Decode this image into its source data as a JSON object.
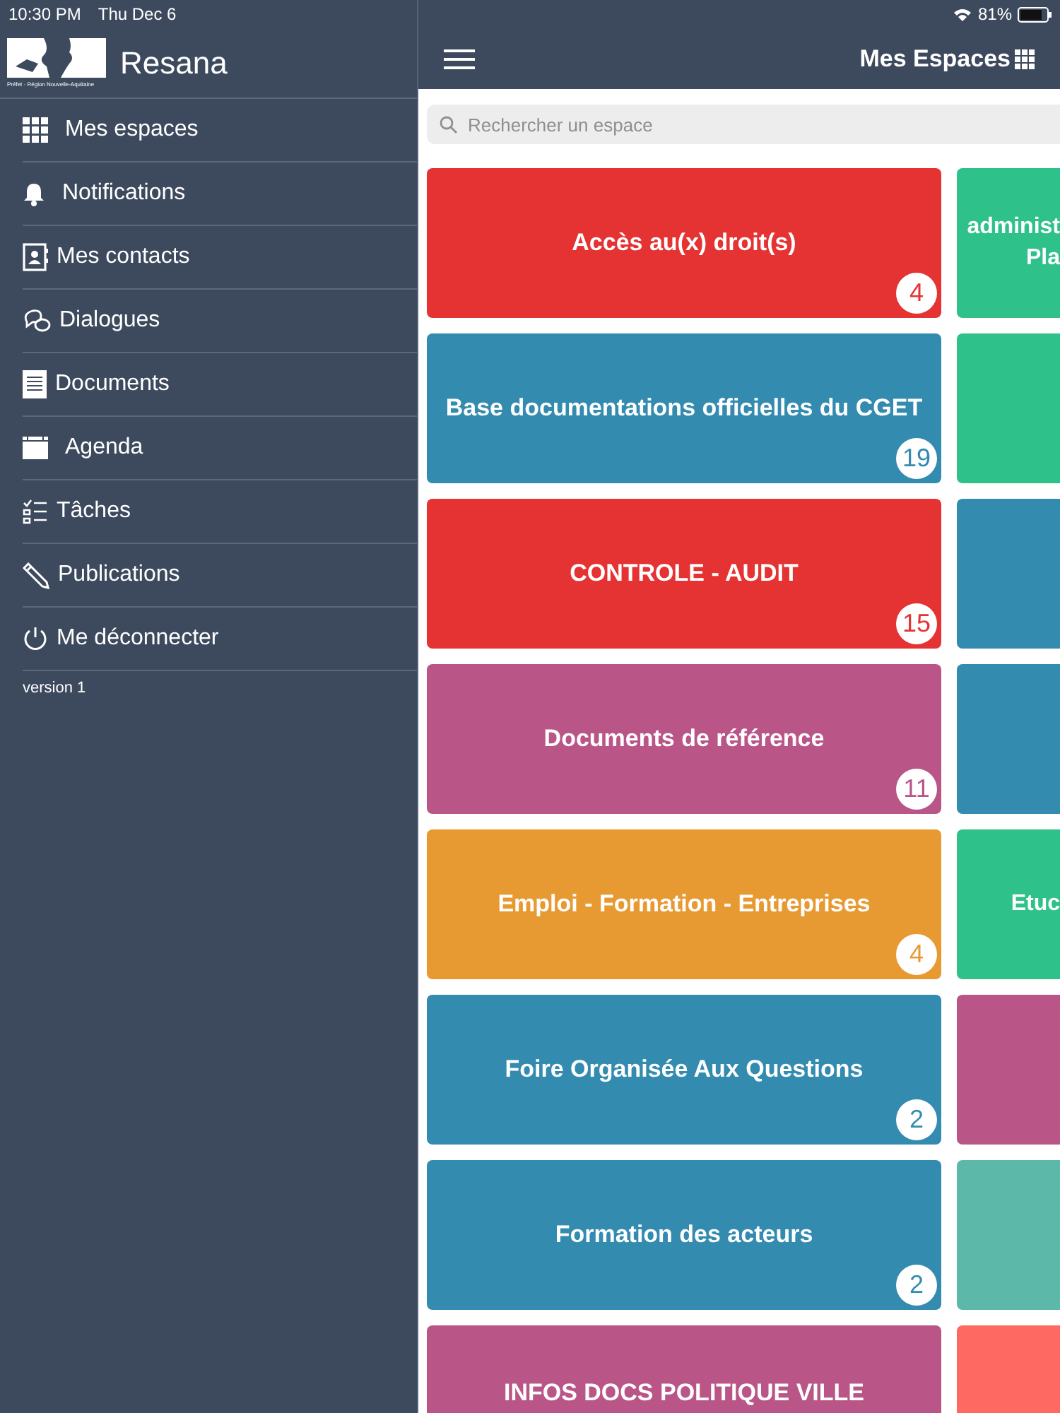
{
  "status_bar": {
    "time": "10:30 PM",
    "date": "Thu Dec 6",
    "battery": "81%"
  },
  "sidebar": {
    "app_name": "Resana",
    "logo_caption": "Préfet · Région Nouvelle-Aquitaine",
    "items": [
      {
        "kind": "grid",
        "label": "Mes espaces"
      },
      {
        "kind": "bell",
        "label": "Notifications"
      },
      {
        "kind": "contacts",
        "label": "Mes contacts"
      },
      {
        "kind": "chat",
        "label": "Dialogues"
      },
      {
        "kind": "document",
        "label": "Documents"
      },
      {
        "kind": "calendar",
        "label": "Agenda"
      },
      {
        "kind": "tasks",
        "label": "Tâches"
      },
      {
        "kind": "pencil",
        "label": "Publications"
      },
      {
        "kind": "power",
        "label": "Me déconnecter"
      }
    ],
    "version": "version 1"
  },
  "header": {
    "title": "Mes Espaces"
  },
  "search": {
    "placeholder": "Rechercher un espace"
  },
  "spaces": [
    {
      "left": {
        "title": "Accès au(x) droit(s)",
        "badge": "4",
        "color": "#e53232"
      },
      "right": {
        "title_lines": [
          "administ",
          "Pla"
        ],
        "color": "#2ec28a"
      }
    },
    {
      "left": {
        "title": "Base documentations officielles du CGET",
        "badge": "19",
        "color": "#338bb0"
      },
      "right": {
        "color": "#2ec28a"
      }
    },
    {
      "left": {
        "title": "CONTROLE - AUDIT",
        "badge": "15",
        "color": "#e53232"
      },
      "right": {
        "color": "#338bb0"
      }
    },
    {
      "left": {
        "title": "Documents de référence",
        "badge": "11",
        "color": "#b95587"
      },
      "right": {
        "color": "#338bb0"
      }
    },
    {
      "left": {
        "title": "Emploi - Formation - Entreprises",
        "badge": "4",
        "color": "#e89a32"
      },
      "right": {
        "title_lines": [
          "Etuc"
        ],
        "color": "#2ec28a"
      }
    },
    {
      "left": {
        "title": "Foire Organisée Aux Questions",
        "badge": "2",
        "color": "#338bb0"
      },
      "right": {
        "color": "#b95587"
      }
    },
    {
      "left": {
        "title": "Formation des acteurs",
        "badge": "2",
        "color": "#338bb0"
      },
      "right": {
        "color": "#5cb8a8"
      }
    },
    {
      "left": {
        "title": "INFOS DOCS POLITIQUE VILLE",
        "color": "#b95587"
      },
      "right": {
        "color": "#fe6a62"
      }
    }
  ]
}
